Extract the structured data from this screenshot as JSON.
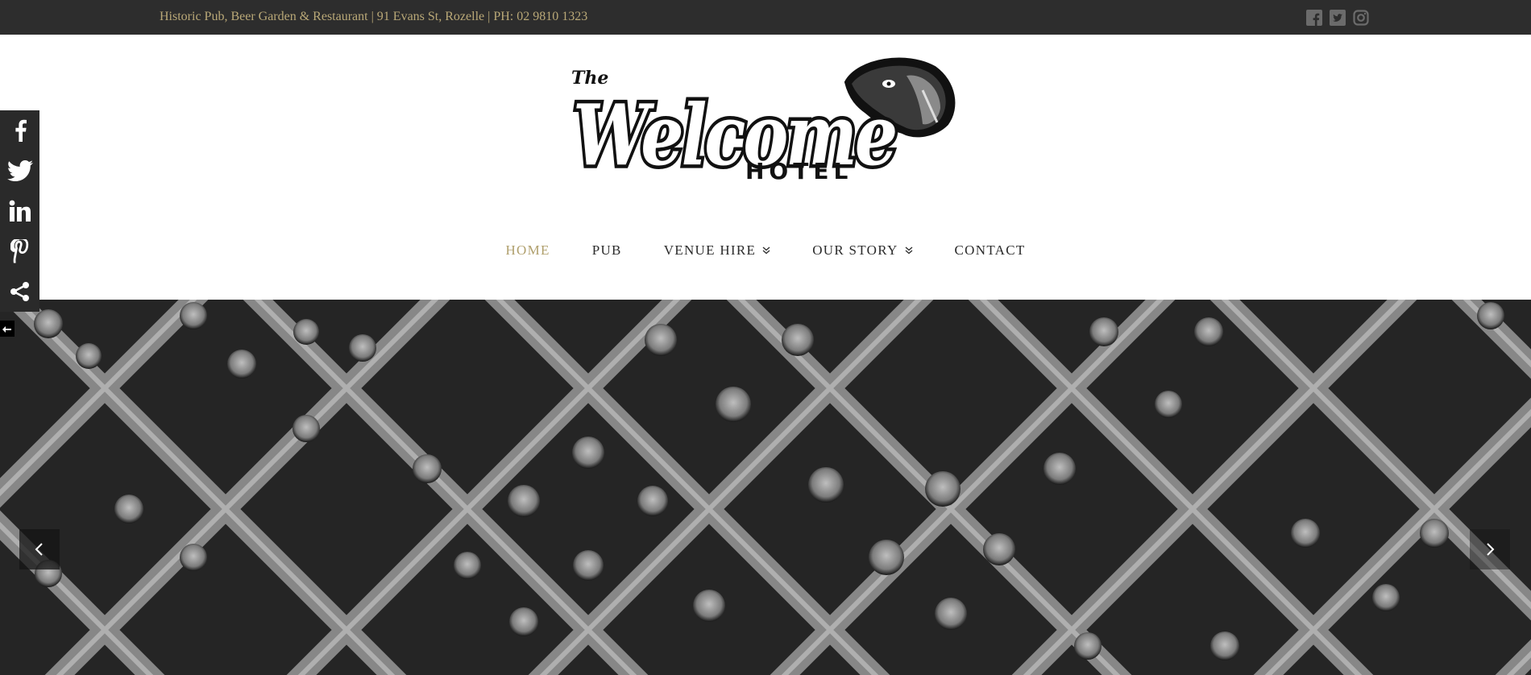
{
  "topbar": {
    "info_text": "Historic Pub, Beer Garden & Restaurant | 91 Evans St, Rozelle | PH: 02 9810 1323",
    "icons": [
      "facebook-icon",
      "twitter-icon",
      "instagram-icon"
    ]
  },
  "logo": {
    "small_text": "The",
    "script_text": "Welcome",
    "block_text": "HOTEL"
  },
  "nav": {
    "items": [
      {
        "label": "HOME",
        "active": true
      },
      {
        "label": "PUB"
      },
      {
        "label": "VENUE HIRE",
        "has_dropdown": true
      },
      {
        "label": "OUR STORY",
        "has_dropdown": true
      },
      {
        "label": "CONTACT"
      }
    ]
  },
  "share": {
    "icons": [
      "facebook-icon",
      "twitter-icon",
      "linkedin-icon",
      "pinterest-icon",
      "share-icon"
    ]
  },
  "slider": {
    "prev_icon": "chevron-left-icon",
    "next_icon": "chevron-right-icon"
  },
  "colors": {
    "topbar_bg": "#2d2d2d",
    "topbar_text": "#b9a877",
    "nav_active": "#b0a06d",
    "nav_text": "#2b2b2b",
    "share_bg": "#2a2a2a"
  }
}
